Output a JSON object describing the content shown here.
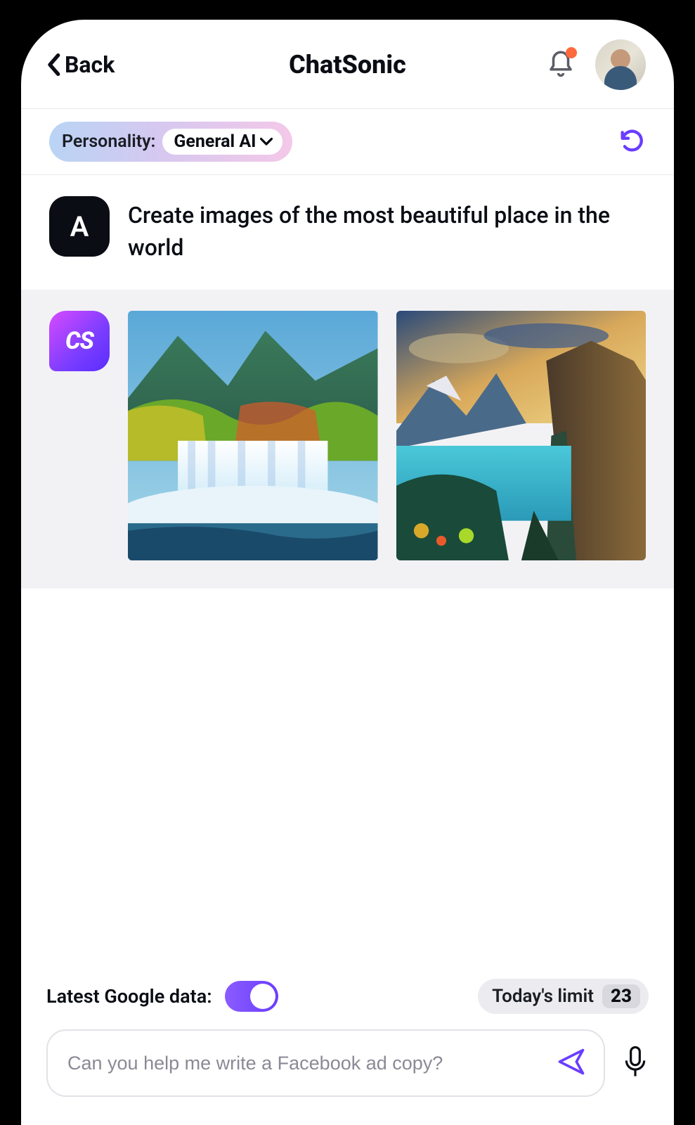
{
  "header": {
    "back_label": "Back",
    "title": "ChatSonic"
  },
  "personality": {
    "label": "Personality:",
    "value": "General AI"
  },
  "messages": {
    "user": {
      "avatar_initial": "A",
      "text": "Create images of the most beautiful place in the world"
    },
    "bot": {
      "avatar_label": "CS"
    }
  },
  "footer": {
    "google_label": "Latest Google data:",
    "google_toggle_on": true,
    "limit_label": "Today's limit",
    "limit_value": "23",
    "input_placeholder": "Can you help me write a Facebook ad copy?"
  }
}
